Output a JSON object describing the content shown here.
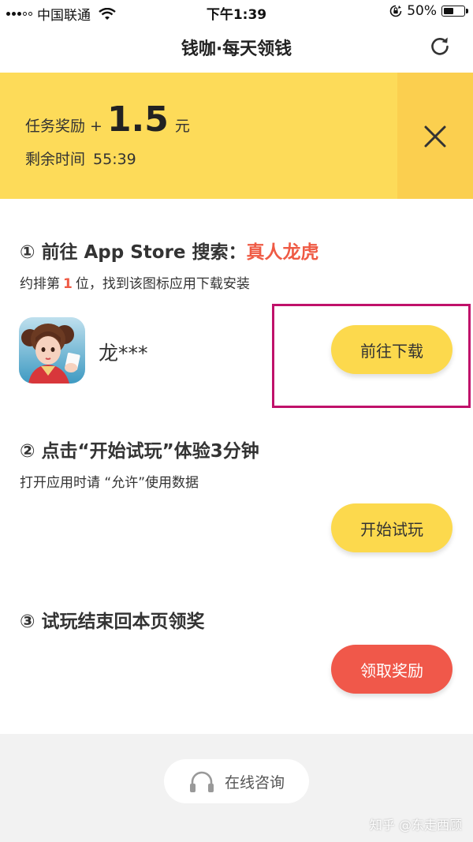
{
  "status_bar": {
    "carrier": "中国联通",
    "time": "下午1:39",
    "battery_percent": "50%",
    "battery_level": 0.5
  },
  "nav": {
    "title": "钱咖·每天领钱",
    "refresh_icon": "refresh-icon"
  },
  "banner": {
    "reward_label": "任务奖励",
    "plus": "+",
    "reward_amount": "1.5",
    "reward_unit": "元",
    "time_label": "剩余时间",
    "time_remaining": "55:39",
    "close_icon": "close-icon",
    "colors": {
      "background": "#fddb59",
      "close_area": "#fbcf4f"
    }
  },
  "step1": {
    "title_prefix": "① 前往 App Store 搜索：",
    "keyword": "真人龙虎",
    "sub_prefix": "约排第",
    "rank": "1",
    "sub_suffix": "位，找到该图标应用下载安装",
    "app_name": "龙***",
    "button": "前往下载"
  },
  "step2": {
    "title": "② 点击“开始试玩”体验3分钟",
    "sub": "打开应用时请 “允许”使用数据",
    "button": "开始试玩"
  },
  "step3": {
    "title": "③ 试玩结束回本页领奖",
    "button": "领取奖励"
  },
  "bottom": {
    "consult_label": "在线咨询",
    "consult_icon": "headset-icon",
    "watermark": "知乎 @东走西顾"
  },
  "colors": {
    "accent_yellow": "#fcd94d",
    "accent_red": "#f0584a",
    "keyword_red": "#ef5a44",
    "highlight_border": "#c0116a"
  }
}
